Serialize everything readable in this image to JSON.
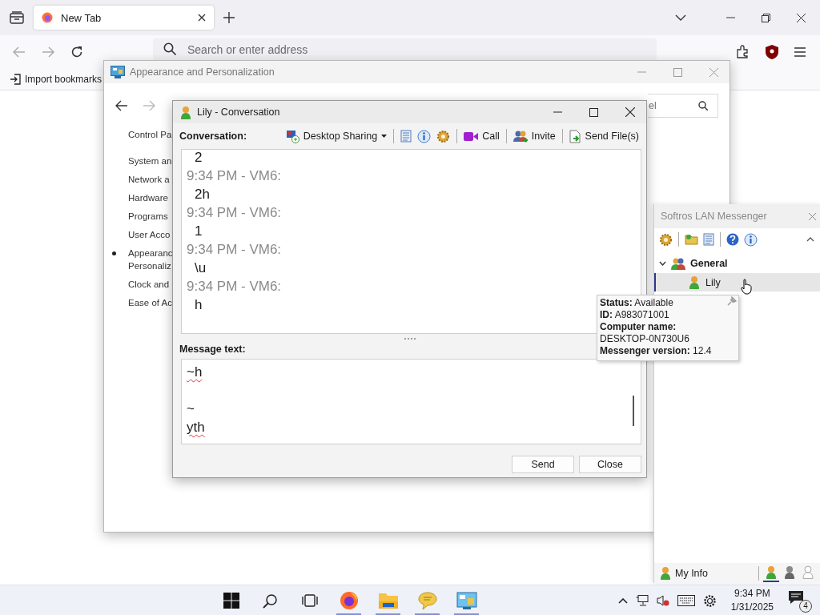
{
  "browser": {
    "tabs": [
      {
        "title": "New Tab",
        "selected": true
      }
    ],
    "address": {
      "placeholder": "Search or enter address"
    },
    "bookmarks": [
      {
        "label": "Import bookmarks"
      }
    ]
  },
  "control_panel": {
    "title": "Appearance and Personalization",
    "search": {
      "value": "el"
    },
    "sidebar": [
      {
        "kind": "home",
        "lines": [
          "Control Pa"
        ],
        "selected": false
      },
      {
        "kind": "category",
        "lines": [
          "System an"
        ],
        "selected": false
      },
      {
        "kind": "category",
        "lines": [
          "Network a"
        ],
        "selected": false
      },
      {
        "kind": "category",
        "lines": [
          "Hardware"
        ],
        "selected": false
      },
      {
        "kind": "category",
        "lines": [
          "Programs"
        ],
        "selected": false
      },
      {
        "kind": "category",
        "lines": [
          "User Acco"
        ],
        "selected": false
      },
      {
        "kind": "category",
        "lines": [
          "Appearanc",
          "Personaliz"
        ],
        "selected": true
      },
      {
        "kind": "category",
        "lines": [
          "Clock and"
        ],
        "selected": false
      },
      {
        "kind": "category",
        "lines": [
          "Ease of Ac"
        ],
        "selected": false
      }
    ]
  },
  "conversation": {
    "title": "Lily - Conversation",
    "label": "Conversation:",
    "toolbar": [
      {
        "kind": "desktop_sharing",
        "label": "Desktop Sharing"
      },
      {
        "kind": "separator"
      },
      {
        "kind": "history"
      },
      {
        "kind": "info"
      },
      {
        "kind": "settings"
      },
      {
        "kind": "separator"
      },
      {
        "kind": "call",
        "label": "Call"
      },
      {
        "kind": "separator"
      },
      {
        "kind": "invite",
        "label": "Invite"
      },
      {
        "kind": "separator"
      },
      {
        "kind": "send_files",
        "label": "Send File(s)"
      }
    ],
    "messages": [
      {
        "text": "2"
      },
      {
        "header": "9:34 PM - VM6:",
        "text": "2h"
      },
      {
        "header": "9:34 PM - VM6:",
        "text": "1"
      },
      {
        "header": "9:34 PM - VM6:",
        "text": "\\u"
      },
      {
        "header": "9:34 PM - VM6:",
        "text": "h"
      }
    ],
    "message_label": "Message text:",
    "input_lines": [
      {
        "text": "~h",
        "misspelled": true,
        "space_before": false
      },
      {
        "text": "~",
        "misspelled": false,
        "space_before": true
      },
      {
        "text": "yth",
        "misspelled": true,
        "space_before": false
      }
    ],
    "buttons": [
      "Send",
      "Close"
    ]
  },
  "messenger": {
    "title": "Softros LAN Messenger",
    "toolbar": [
      {
        "kind": "settings"
      },
      {
        "kind": "separator"
      },
      {
        "kind": "folder"
      },
      {
        "kind": "history"
      },
      {
        "kind": "separator"
      },
      {
        "kind": "help"
      },
      {
        "kind": "info"
      }
    ],
    "groups": [
      {
        "name": "General",
        "expanded": true,
        "children": [
          {
            "name": "Lily",
            "selected": true
          }
        ]
      }
    ],
    "my_info": "My Info",
    "statuses": [
      {
        "kind": "available",
        "selected": true
      },
      {
        "kind": "away",
        "selected": false
      },
      {
        "kind": "offline",
        "selected": false
      }
    ],
    "tooltip": [
      "**Status:** Available",
      "**ID:** A983071001",
      "**Computer name:** DESKTOP-0N730U6",
      "**Messenger version:** 12.4"
    ]
  },
  "taskbar": {
    "apps": [
      {
        "kind": "start",
        "running": false
      },
      {
        "kind": "search",
        "running": false
      },
      {
        "kind": "task_view",
        "running": false
      },
      {
        "kind": "firefox",
        "running": true
      },
      {
        "kind": "explorer",
        "running": true
      },
      {
        "kind": "messenger",
        "running": true
      },
      {
        "kind": "control_panel",
        "running": true
      }
    ],
    "time": "9:34 PM",
    "date": "1/31/2025",
    "notifications": "4"
  }
}
